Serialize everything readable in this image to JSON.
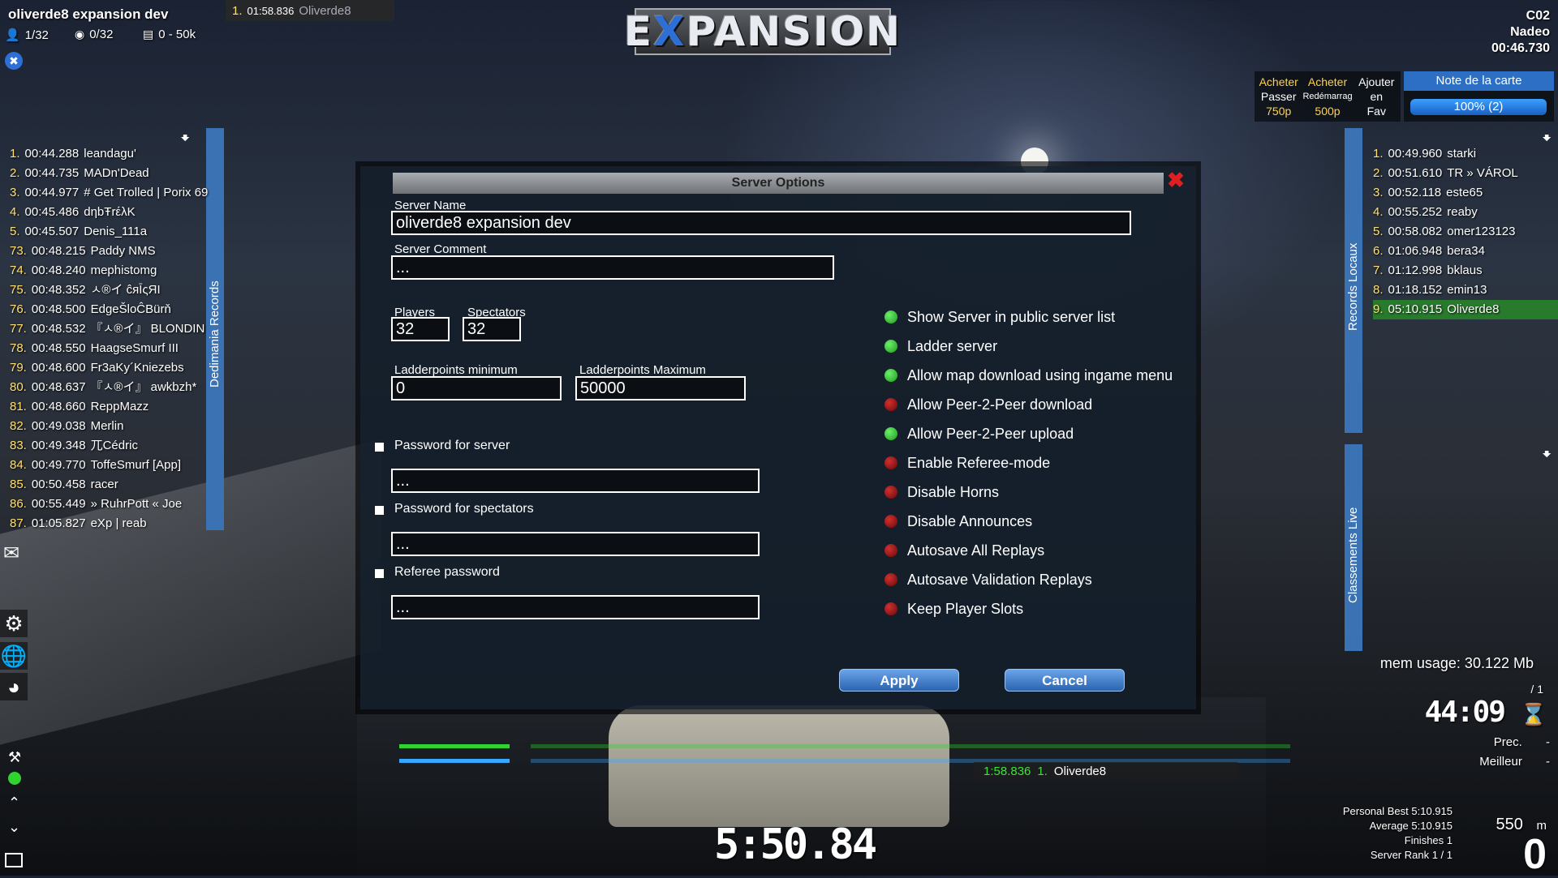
{
  "server": {
    "title": "oliverde8 expansion dev",
    "players": "1/32",
    "spectators": "0/32",
    "ladder": "0 - 50k"
  },
  "top_record": {
    "rank": "1.",
    "time": "01:58.836",
    "name": "Oliverde8"
  },
  "logo": {
    "pre": "E",
    "x": "X",
    "post": "PANSION"
  },
  "map_info": {
    "name": "C02",
    "author": "Nadeo",
    "time": "00:46.730"
  },
  "shop": [
    {
      "top": "Acheter",
      "mid": "Passer",
      "price": "750p"
    },
    {
      "top": "Acheter",
      "mid": "Redémarrag",
      "price": "500p"
    },
    {
      "top": "Ajouter",
      "mid": "en",
      "price": "Fav"
    }
  ],
  "rating": {
    "title": "Note de la carte",
    "value": "100% (2)"
  },
  "dedimania": {
    "label": "Dedimania Records",
    "rows": [
      {
        "rank": "1.",
        "time": "00:44.288",
        "name": "leandagu'"
      },
      {
        "rank": "2.",
        "time": "00:44.735",
        "name": "MADn'Dead"
      },
      {
        "rank": "3.",
        "time": "00:44.977",
        "name": "# Get Trolled | Porix 69"
      },
      {
        "rank": "4.",
        "time": "00:45.486",
        "name": "dηbŦrέλK"
      },
      {
        "rank": "5.",
        "time": "00:45.507",
        "name": "Denis_111a"
      },
      {
        "rank": "73.",
        "time": "00:48.215",
        "name": "Paddy NMS"
      },
      {
        "rank": "74.",
        "time": "00:48.240",
        "name": "mephistomg"
      },
      {
        "rank": "75.",
        "time": "00:48.352",
        "name": "ㅅ®イ ĉяĪςЯΙ"
      },
      {
        "rank": "76.",
        "time": "00:48.500",
        "name": "EdgeŠloĈBürň"
      },
      {
        "rank": "77.",
        "time": "00:48.532",
        "name": "『ㅅ®イ』 BLONDIN"
      },
      {
        "rank": "78.",
        "time": "00:48.550",
        "name": "HaagseSmurf III"
      },
      {
        "rank": "79.",
        "time": "00:48.600",
        "name": "Fr3aKy´Kniezebs"
      },
      {
        "rank": "80.",
        "time": "00:48.637",
        "name": "『ㅅ®イ』 awkbzh*"
      },
      {
        "rank": "81.",
        "time": "00:48.660",
        "name": "ReppMazz"
      },
      {
        "rank": "82.",
        "time": "00:49.038",
        "name": "Merlin"
      },
      {
        "rank": "83.",
        "time": "00:49.348",
        "name": "兀Cédric"
      },
      {
        "rank": "84.",
        "time": "00:49.770",
        "name": "ToffeSmurf [App]"
      },
      {
        "rank": "85.",
        "time": "00:50.458",
        "name": "racer"
      },
      {
        "rank": "86.",
        "time": "00:55.449",
        "name": "» RuhrPott « Joe"
      },
      {
        "rank": "87.",
        "time": "01:05.827",
        "name": "eXp | reab"
      }
    ]
  },
  "local_records": {
    "label": "Records Locaux",
    "rows": [
      {
        "rank": "1.",
        "time": "00:49.960",
        "name": "starki"
      },
      {
        "rank": "2.",
        "time": "00:51.610",
        "name": "TR » VÁROL"
      },
      {
        "rank": "3.",
        "time": "00:52.118",
        "name": "este65"
      },
      {
        "rank": "4.",
        "time": "00:55.252",
        "name": "reaby"
      },
      {
        "rank": "5.",
        "time": "00:58.082",
        "name": "omer123123"
      },
      {
        "rank": "6.",
        "time": "01:06.948",
        "name": "bera34"
      },
      {
        "rank": "7.",
        "time": "01:12.998",
        "name": "bklaus"
      },
      {
        "rank": "8.",
        "time": "01:18.152",
        "name": "emin13"
      },
      {
        "rank": "9.",
        "time": "05:10.915",
        "name": "Oliverde8"
      }
    ]
  },
  "live": {
    "label": "Classements Live"
  },
  "dialog": {
    "title": "Server Options",
    "server_name_label": "Server Name",
    "server_name_value": "oliverde8 expansion dev",
    "server_comment_label": "Server Comment",
    "server_comment_value": "...",
    "players_label": "Players",
    "players_value": "32",
    "spectators_label": "Spectators",
    "spectators_value": "32",
    "lp_min_label": "Ladderpoints minimum",
    "lp_min_value": "0",
    "lp_max_label": "Ladderpoints Maximum",
    "lp_max_value": "50000",
    "pw_server_label": "Password for server",
    "pw_server_value": "...",
    "pw_spec_label": "Password for spectators",
    "pw_spec_value": "...",
    "referee_label": "Referee password",
    "referee_value": "...",
    "options": [
      {
        "label": "Show Server in public server list",
        "on": true
      },
      {
        "label": "Ladder server",
        "on": true
      },
      {
        "label": "Allow map download using ingame menu",
        "on": true
      },
      {
        "label": "Allow Peer-2-Peer download",
        "on": false
      },
      {
        "label": "Allow Peer-2-Peer upload",
        "on": true
      },
      {
        "label": "Enable Referee-mode",
        "on": false
      },
      {
        "label": "Disable Horns",
        "on": false
      },
      {
        "label": "Disable Announces",
        "on": false
      },
      {
        "label": "Autosave All Replays",
        "on": false
      },
      {
        "label": "Autosave Validation Replays",
        "on": false
      },
      {
        "label": "Keep Player Slots",
        "on": false
      }
    ],
    "apply_label": "Apply",
    "cancel_label": "Cancel"
  },
  "hud": {
    "race_time": "5:50.84",
    "checkpoint_time": "1:58.836",
    "checkpoint_rank": "1.",
    "checkpoint_name": "Oliverde8",
    "mem_usage": "mem usage: 30.122 Mb",
    "lap": "/ 1",
    "clock": "44:09",
    "prec_label": "Prec.",
    "prec_value": "-",
    "best_label": "Meilleur",
    "best_value": "-",
    "personal_best": "Personal Best 5:10.915",
    "average": "Average 5:10.915",
    "finishes": "Finishes 1",
    "server_rank": "Server Rank 1 / 1",
    "distance": "550",
    "distance_unit": "m",
    "speed": "0"
  }
}
